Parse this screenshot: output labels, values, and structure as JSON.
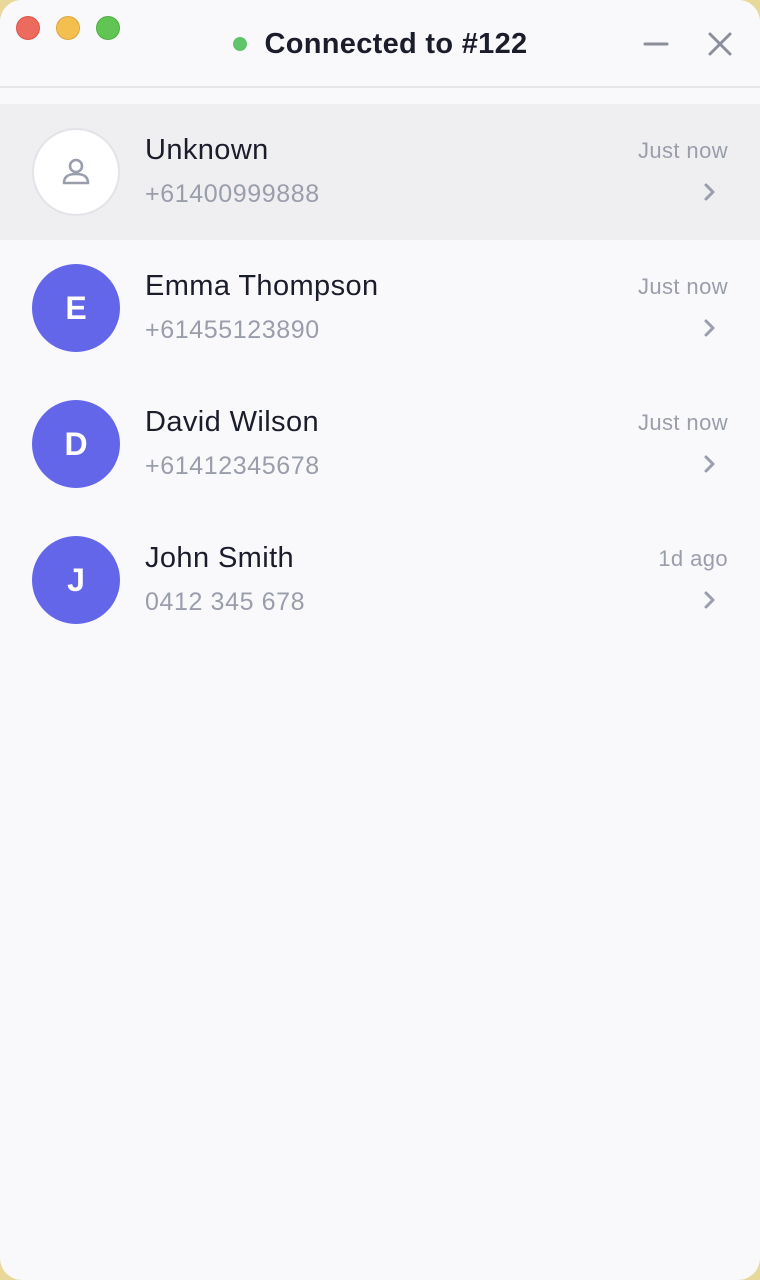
{
  "window": {
    "status_text": "Connected to #122",
    "status_color": "#5fc46a",
    "controls": [
      "minimize-icon",
      "close-icon"
    ]
  },
  "contacts": [
    {
      "name": "Unknown",
      "phone": "+61400999888",
      "time": "Just now",
      "avatar": "person-icon",
      "selected": true
    },
    {
      "name": "Emma Thompson",
      "phone": "+61455123890",
      "time": "Just now",
      "avatar": "E",
      "selected": false
    },
    {
      "name": "David Wilson",
      "phone": "+61412345678",
      "time": "Just now",
      "avatar": "D",
      "selected": false
    },
    {
      "name": "John Smith",
      "phone": "0412 345 678",
      "time": "1d ago",
      "avatar": "J",
      "selected": false
    }
  ],
  "colors": {
    "avatar_accent": "#6366e8",
    "selected_row": "#efeff2",
    "text_primary": "#1b1d2b",
    "text_secondary": "#9a9eab"
  }
}
